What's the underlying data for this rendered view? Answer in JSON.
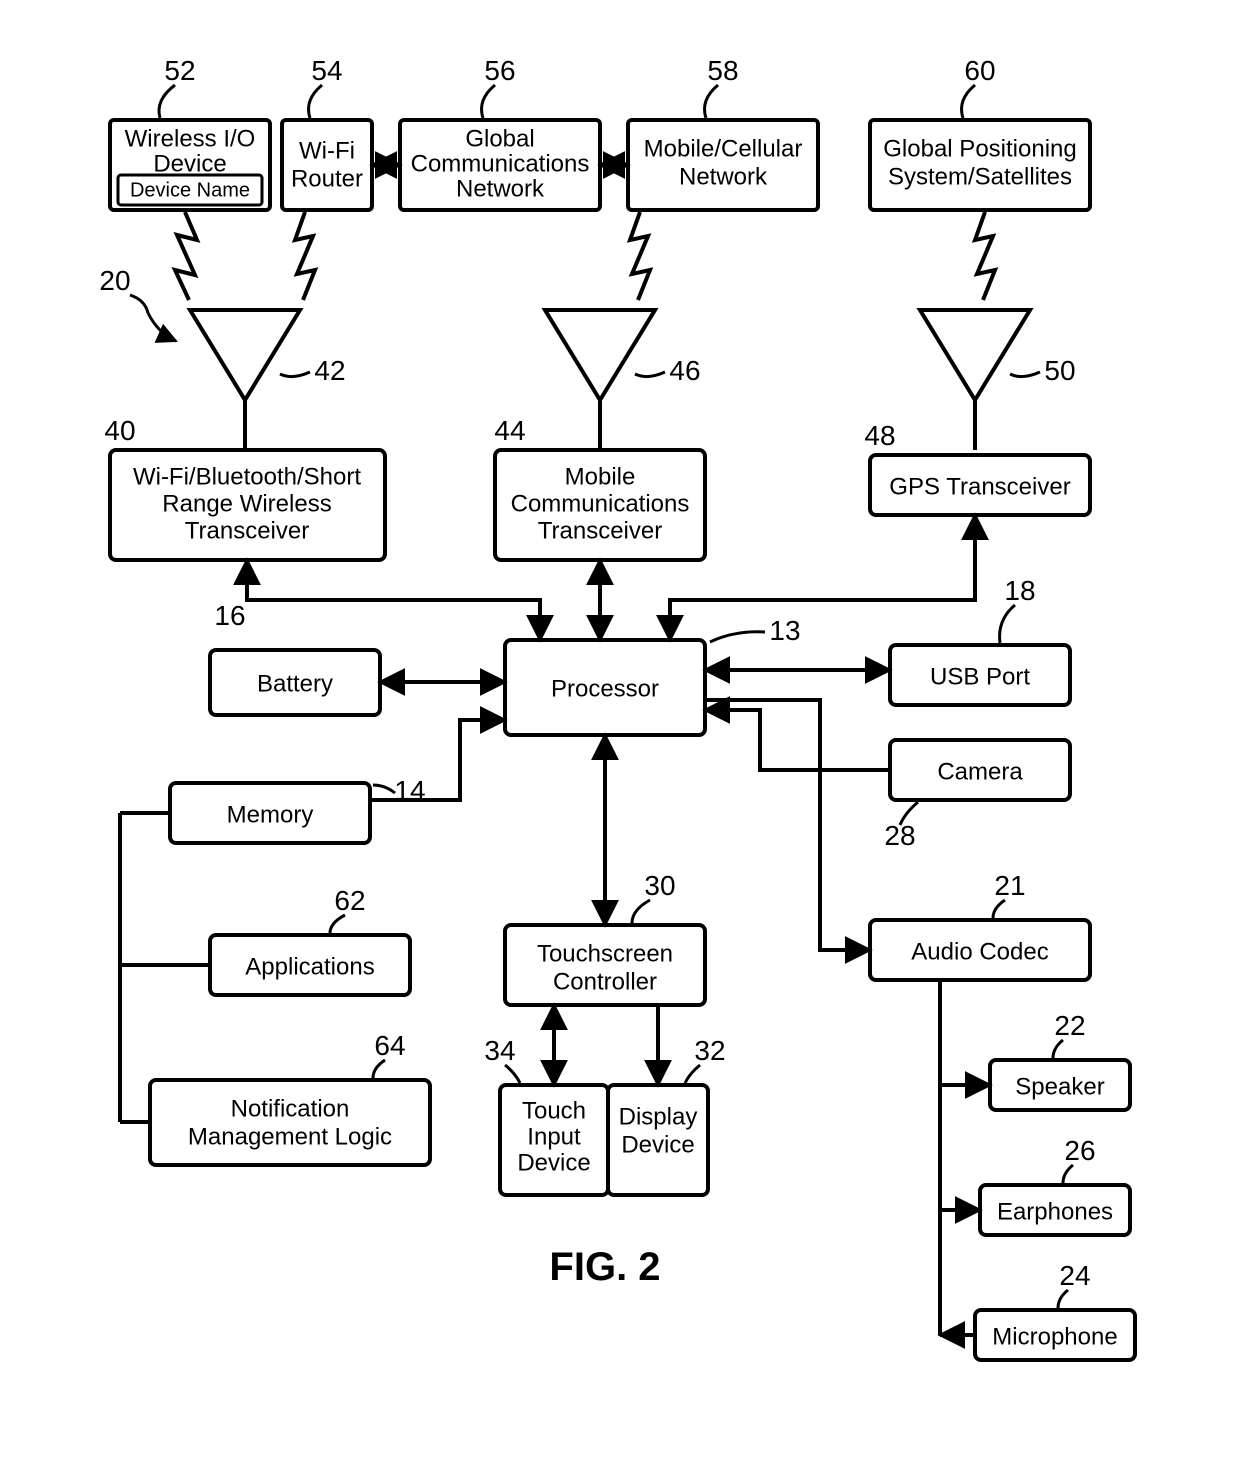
{
  "figure_label": "FIG. 2",
  "refs": {
    "n52": "52",
    "n54": "54",
    "n56": "56",
    "n58": "58",
    "n60": "60",
    "n20": "20",
    "n42": "42",
    "n46": "46",
    "n50": "50",
    "n40": "40",
    "n44": "44",
    "n48": "48",
    "n16": "16",
    "n14": "14",
    "n62": "62",
    "n64": "64",
    "n13": "13",
    "n18": "18",
    "n28": "28",
    "n30": "30",
    "n34": "34",
    "n32": "32",
    "n21": "21",
    "n22": "22",
    "n26": "26",
    "n24": "24"
  },
  "boxes": {
    "wireless_io_l1": "Wireless I/O",
    "wireless_io_l2": "Device",
    "device_name": "Device Name",
    "wifi_router_l1": "Wi-Fi",
    "wifi_router_l2": "Router",
    "gcn_l1": "Global",
    "gcn_l2": "Communications",
    "gcn_l3": "Network",
    "mobile_net_l1": "Mobile/Cellular",
    "mobile_net_l2": "Network",
    "gps_sat_l1": "Global Positioning",
    "gps_sat_l2": "System/Satellites",
    "wifi_trx_l1": "Wi-Fi/Bluetooth/Short",
    "wifi_trx_l2": "Range Wireless",
    "wifi_trx_l3": "Transceiver",
    "mob_trx_l1": "Mobile",
    "mob_trx_l2": "Communications",
    "mob_trx_l3": "Transceiver",
    "gps_trx": "GPS Transceiver",
    "battery": "Battery",
    "processor": "Processor",
    "usb": "USB Port",
    "camera": "Camera",
    "memory": "Memory",
    "apps": "Applications",
    "notif_l1": "Notification",
    "notif_l2": "Management Logic",
    "ts_ctrl_l1": "Touchscreen",
    "ts_ctrl_l2": "Controller",
    "touch_inp_l1": "Touch",
    "touch_inp_l2": "Input",
    "touch_inp_l3": "Device",
    "display_l1": "Display",
    "display_l2": "Device",
    "audio_codec": "Audio Codec",
    "speaker": "Speaker",
    "earphones": "Earphones",
    "microphone": "Microphone"
  }
}
